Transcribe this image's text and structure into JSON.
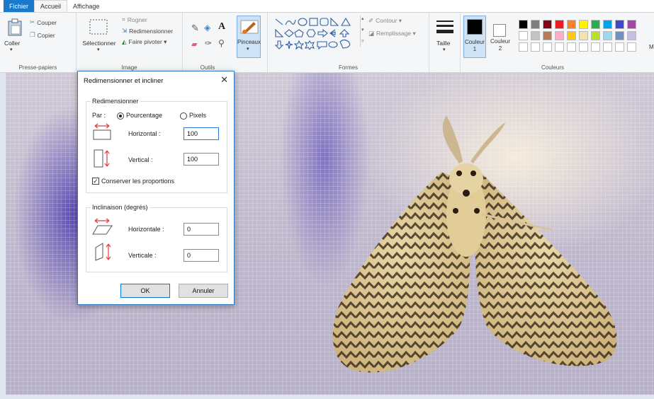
{
  "tabs": {
    "file": "Fichier",
    "home": "Accueil",
    "view": "Affichage"
  },
  "clipboard": {
    "paste": "Coller",
    "cut": "Couper",
    "copy": "Copier",
    "label": "Presse-papiers"
  },
  "image": {
    "select": "Sélectionner",
    "crop": "Rogner",
    "resize": "Redimensionner",
    "rotate": "Faire pivoter ▾",
    "label": "Image"
  },
  "tools": {
    "label": "Outils",
    "brushes": "Pinceaux"
  },
  "shapes": {
    "outline": "Contour ▾",
    "fill": "Remplissage ▾",
    "label": "Formes"
  },
  "size": {
    "label": "Taille"
  },
  "colors": {
    "color1": "Couleur",
    "color1_num": "1",
    "color2": "Couleur",
    "color2_num": "2",
    "label": "Couleurs",
    "edit_cut": "M",
    "row1": [
      "#000000",
      "#7f7f7f",
      "#880015",
      "#ed1c24",
      "#ff7f27",
      "#fff200",
      "#22b14c",
      "#00a2e8",
      "#3f48cc",
      "#a349a4"
    ],
    "row2": [
      "#ffffff",
      "#c3c3c3",
      "#b97a57",
      "#ffaec9",
      "#ffc90e",
      "#efe4b0",
      "#b5e61d",
      "#99d9ea",
      "#7092be",
      "#c8bfe7"
    ]
  },
  "dialog": {
    "title": "Redimensionner et incliner",
    "resize_legend": "Redimensionner",
    "by": "Par :",
    "percent": "Pourcentage",
    "pixels": "Pixels",
    "horizontal": "Horizontal :",
    "horizontal_value": "100",
    "vertical": "Vertical :",
    "vertical_value": "100",
    "keep_ratio": "Conserver les proportions",
    "skew_legend": "Inclinaison (degrés)",
    "skew_h": "Horizontale :",
    "skew_h_value": "0",
    "skew_v": "Verticale :",
    "skew_v_value": "0",
    "ok": "OK",
    "cancel": "Annuler"
  }
}
